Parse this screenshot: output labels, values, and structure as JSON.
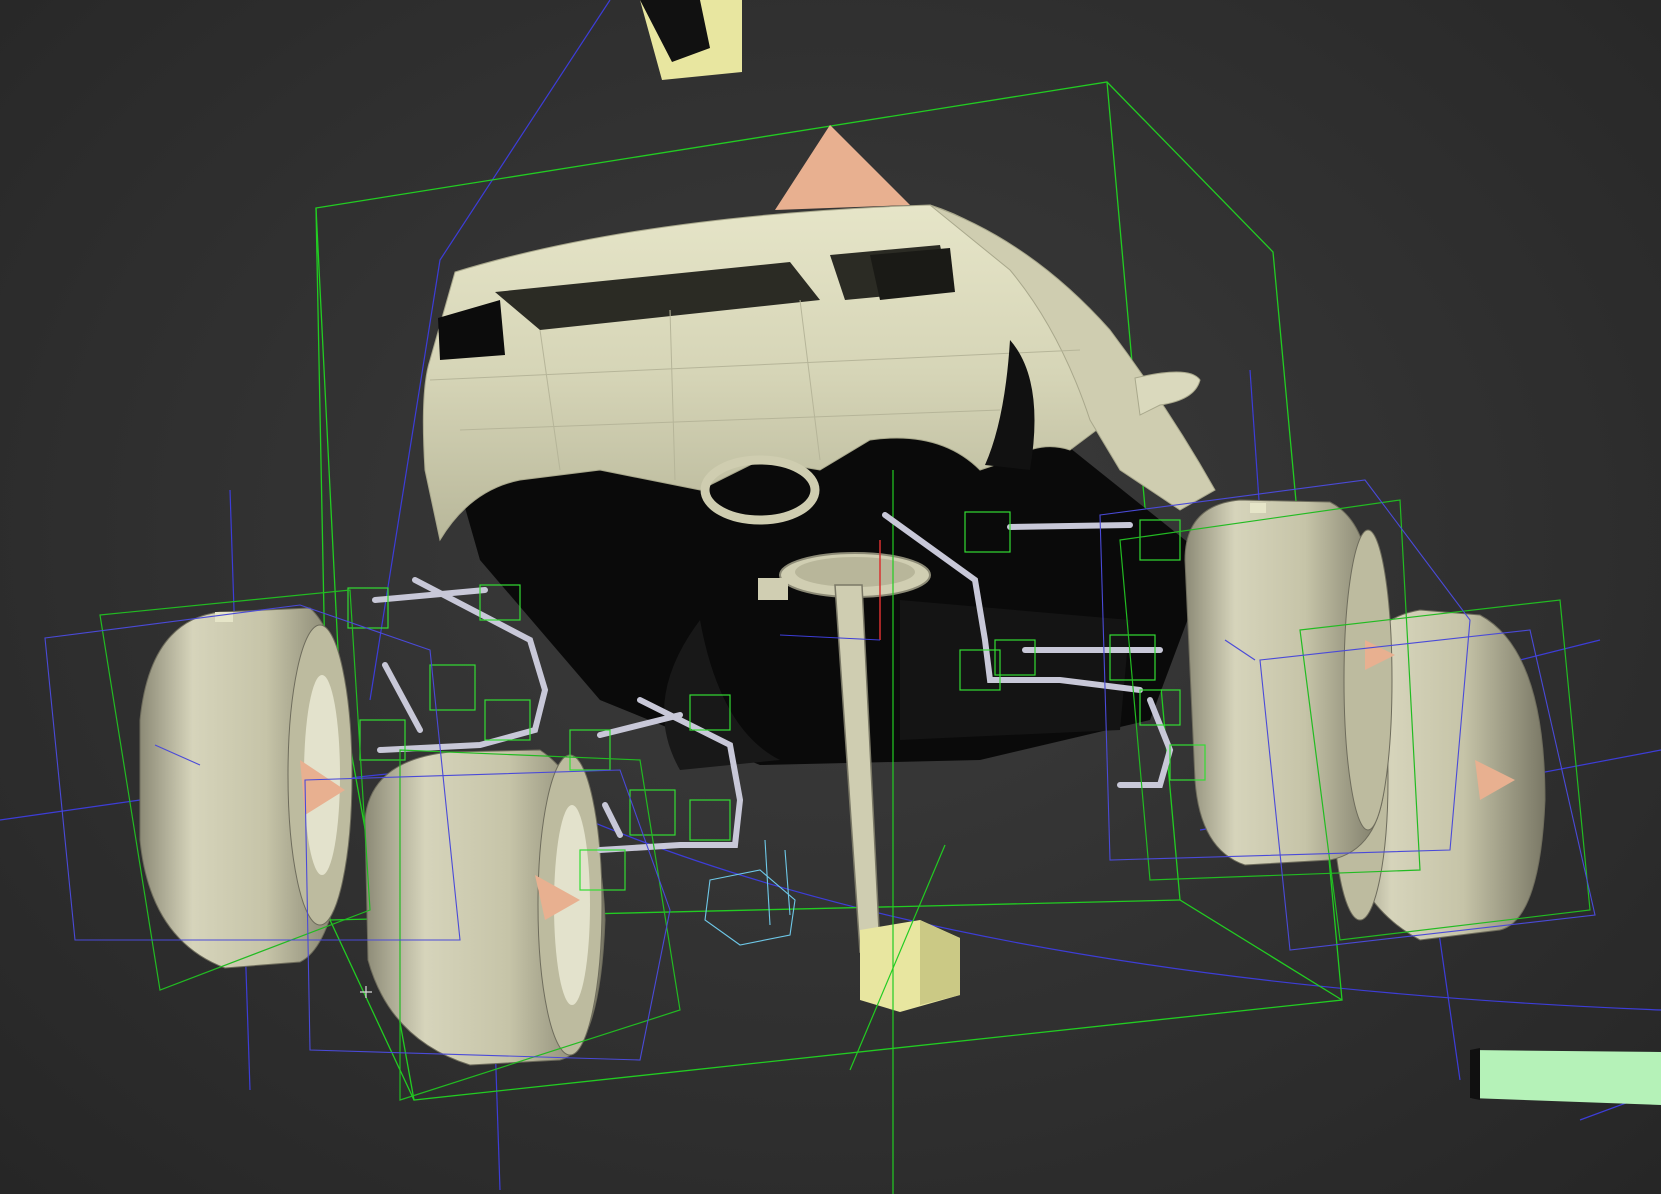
{
  "viewport": {
    "background": "#333333",
    "shading": "smooth",
    "selection_color": "#22cc22",
    "helper_color": "#3d3dd8"
  },
  "scene": {
    "objects": [
      {
        "name": "car-body",
        "color": "#d9d8b8"
      },
      {
        "name": "wheel-front-left",
        "color": "#cfcdb1"
      },
      {
        "name": "wheel-rear-left",
        "color": "#cfcdb1"
      },
      {
        "name": "wheel-front-right",
        "color": "#cfcdb1"
      },
      {
        "name": "wheel-rear-right",
        "color": "#cfcdb1"
      },
      {
        "name": "steering-column",
        "color": "#cfcdb1"
      },
      {
        "name": "control-block",
        "color": "#e8e6a0"
      },
      {
        "name": "pyramid-marker",
        "color": "#e8b090"
      },
      {
        "name": "green-slab",
        "color": "#b5f2b8"
      }
    ],
    "bones_color": "#c8c8d8",
    "ik_helper_color": "#33dd33"
  }
}
